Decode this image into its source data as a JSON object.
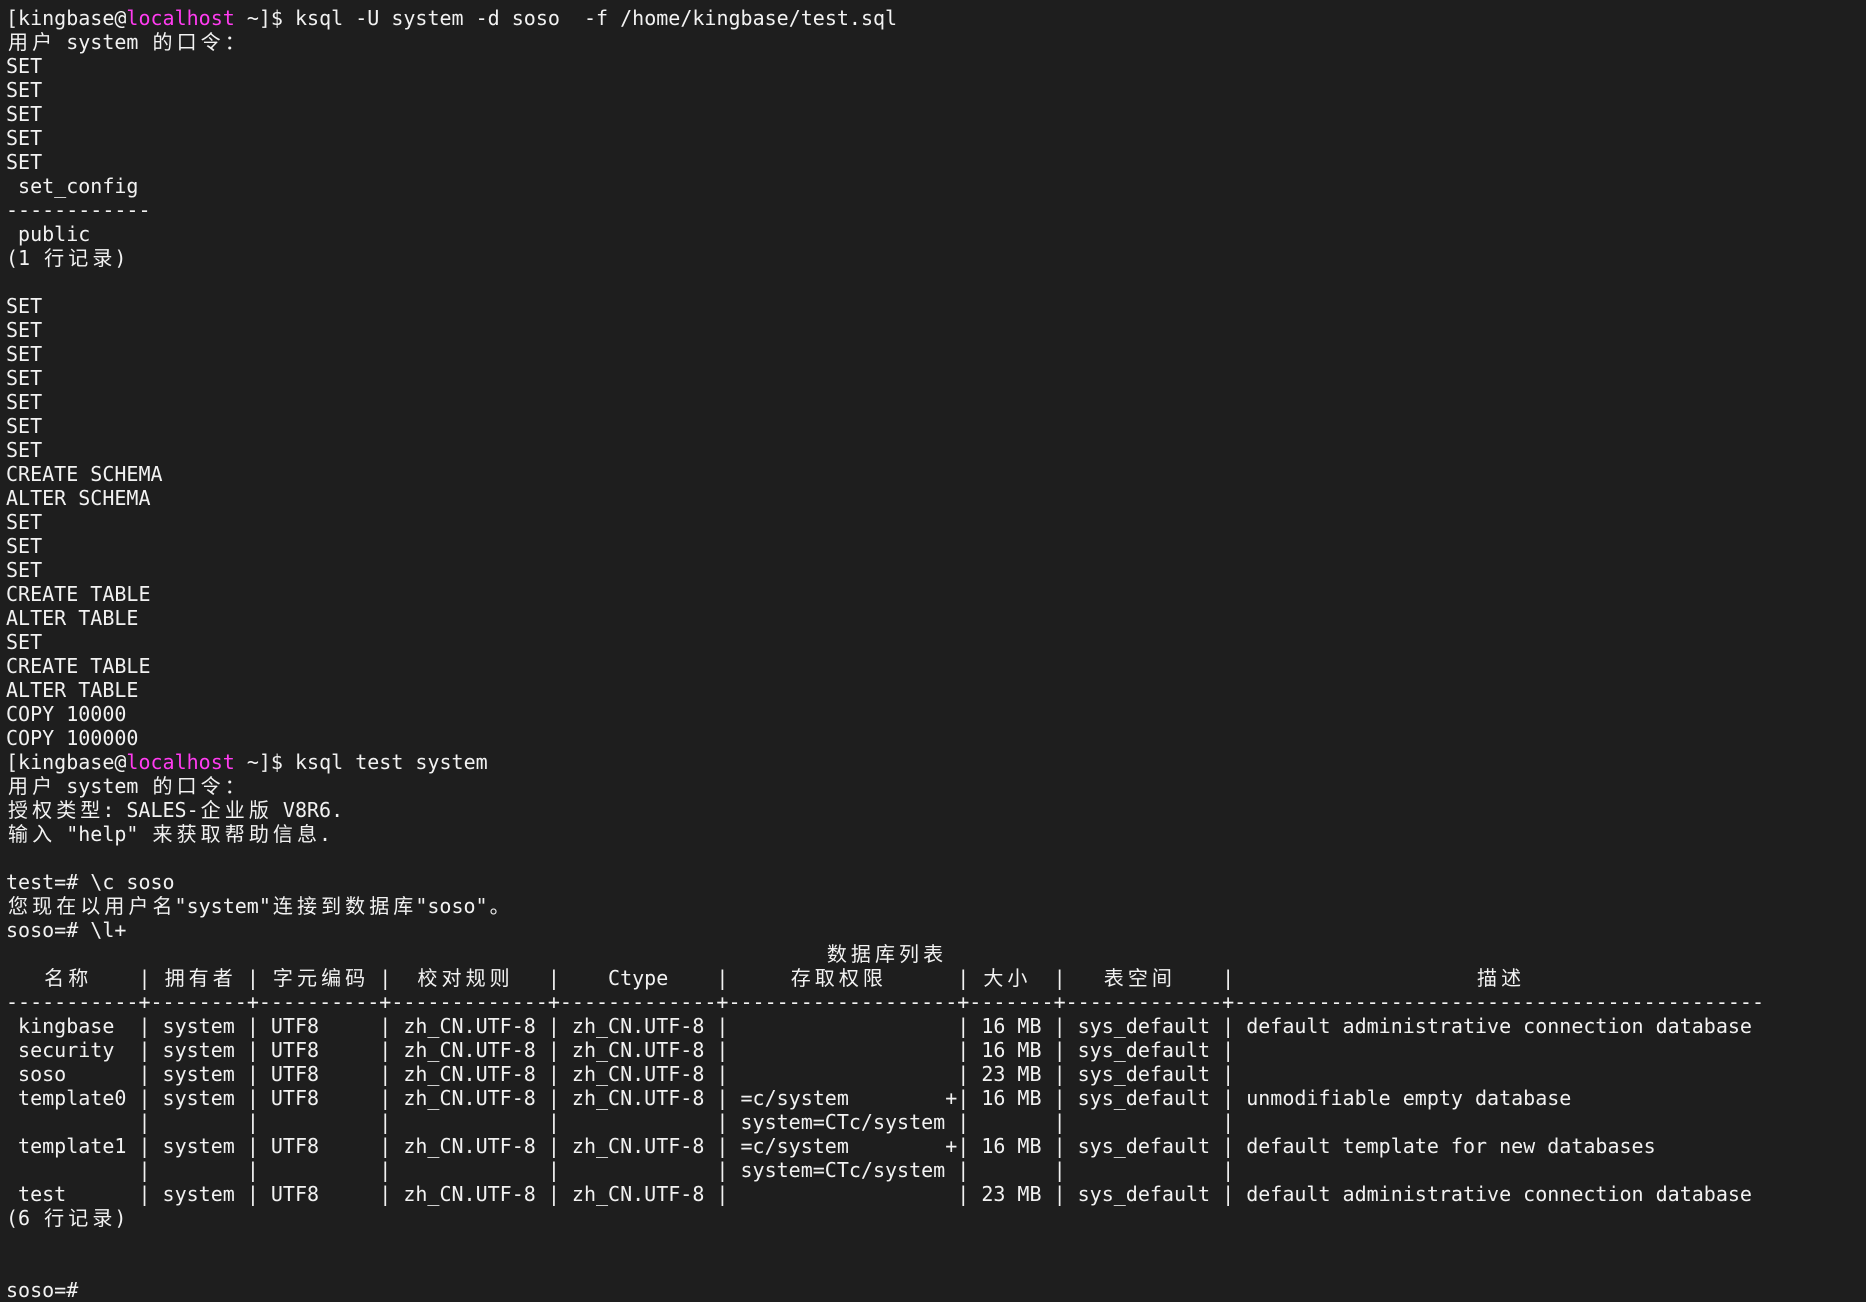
{
  "colors": {
    "background": "#1e1e1e",
    "foreground": "#f2f2f2",
    "hostname": "#ff3cf0"
  },
  "session": [
    {
      "user_part": "[kingbase@",
      "host": "localhost",
      "path_part": " ~]$ ",
      "command": "ksql -U system -d soso  -f /home/kingbase/test.sql"
    },
    {
      "text": "用户 system 的口令："
    },
    {
      "text": "SET"
    },
    {
      "text": "SET"
    },
    {
      "text": "SET"
    },
    {
      "text": "SET"
    },
    {
      "text": "SET"
    },
    {
      "text": " set_config"
    },
    {
      "text": "------------"
    },
    {
      "text": " public"
    },
    {
      "text": "(1 行记录)"
    },
    {},
    {
      "text": "SET"
    },
    {
      "text": "SET"
    },
    {
      "text": "SET"
    },
    {
      "text": "SET"
    },
    {
      "text": "SET"
    },
    {
      "text": "SET"
    },
    {
      "text": "SET"
    },
    {
      "text": "CREATE SCHEMA"
    },
    {
      "text": "ALTER SCHEMA"
    },
    {
      "text": "SET"
    },
    {
      "text": "SET"
    },
    {
      "text": "SET"
    },
    {
      "text": "CREATE TABLE"
    },
    {
      "text": "ALTER TABLE"
    },
    {
      "text": "SET"
    },
    {
      "text": "CREATE TABLE"
    },
    {
      "text": "ALTER TABLE"
    },
    {
      "text": "COPY 10000"
    },
    {
      "text": "COPY 100000"
    },
    {
      "user_part": "[kingbase@",
      "host": "localhost",
      "path_part": " ~]$ ",
      "command": "ksql test system"
    },
    {
      "text": "用户 system 的口令："
    },
    {
      "text": "授权类型: SALES-企业版 V8R6."
    },
    {
      "text": "输入 \"help\" 来获取帮助信息."
    },
    {},
    {
      "text": "test=# \\c soso"
    },
    {
      "text": "您现在以用户名\"system\"连接到数据库\"soso\"。"
    },
    {
      "text": "soso=# \\l+"
    }
  ],
  "db_list": {
    "title": "数据库列表",
    "headers": [
      "名称",
      "拥有者",
      "字元编码",
      "校对规则",
      "Ctype",
      "存取权限",
      "大小",
      "表空间",
      "描述"
    ],
    "rule": "-----------+--------+----------+-------------+-------------+-------------------+-------+-------------+--------------------------------------------",
    "separator": "|",
    "wrap_marker": "+",
    "rows": [
      {
        "name": "kingbase",
        "owner": "system",
        "encoding": "UTF8",
        "collate": "zh_CN.UTF-8",
        "ctype": "zh_CN.UTF-8",
        "size": "16 MB",
        "tablespace": "sys_default",
        "description": "default administrative connection database"
      },
      {
        "name": "security",
        "owner": "system",
        "encoding": "UTF8",
        "collate": "zh_CN.UTF-8",
        "ctype": "zh_CN.UTF-8",
        "size": "16 MB",
        "tablespace": "sys_default"
      },
      {
        "name": "soso",
        "owner": "system",
        "encoding": "UTF8",
        "collate": "zh_CN.UTF-8",
        "ctype": "zh_CN.UTF-8",
        "size": "23 MB",
        "tablespace": "sys_default"
      },
      {
        "name": "template0",
        "owner": "system",
        "encoding": "UTF8",
        "collate": "zh_CN.UTF-8",
        "ctype": "zh_CN.UTF-8",
        "access_privileges": [
          "=c/system",
          "system=CTc/system"
        ],
        "size": "16 MB",
        "tablespace": "sys_default",
        "description": "unmodifiable empty database"
      },
      {
        "name": "template1",
        "owner": "system",
        "encoding": "UTF8",
        "collate": "zh_CN.UTF-8",
        "ctype": "zh_CN.UTF-8",
        "access_privileges": [
          "=c/system",
          "system=CTc/system"
        ],
        "size": "16 MB",
        "tablespace": "sys_default",
        "description": "default template for new databases"
      },
      {
        "name": "test",
        "owner": "system",
        "encoding": "UTF8",
        "collate": "zh_CN.UTF-8",
        "ctype": "zh_CN.UTF-8",
        "size": "23 MB",
        "tablespace": "sys_default",
        "description": "default administrative connection database"
      }
    ],
    "footer": "(6 行记录)"
  },
  "final_prompt": "soso=#"
}
